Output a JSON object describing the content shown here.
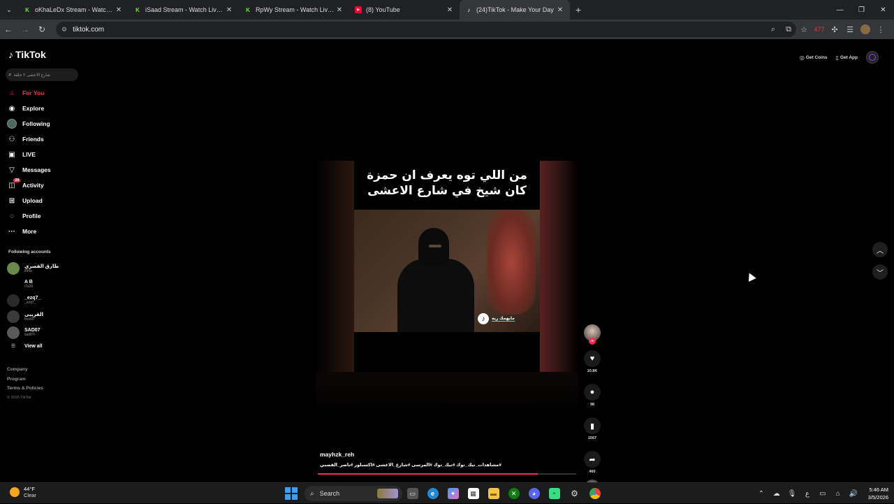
{
  "browser": {
    "tabs": [
      {
        "title": "oKhaLeDx Stream - Watch Live",
        "favicon": "kick-icon",
        "active": false
      },
      {
        "title": "iSaad Stream - Watch Live on K",
        "favicon": "kick-icon",
        "active": false
      },
      {
        "title": "RpWy Stream - Watch Live on K",
        "favicon": "kick-icon",
        "active": false
      },
      {
        "title": "(8) YouTube",
        "favicon": "youtube-icon",
        "active": false
      },
      {
        "title": "(24)TikTok - Make Your Day",
        "favicon": "tiktok-icon",
        "active": true
      }
    ],
    "url": "tiktok.com",
    "extension_badge": "477"
  },
  "sidebar": {
    "logo": "TikTok",
    "search_placeholder": "شارع الاعشى ٢ حلقة",
    "nav": [
      {
        "label": "For You",
        "icon": "home-icon",
        "active": true
      },
      {
        "label": "Explore",
        "icon": "compass-icon",
        "active": false
      },
      {
        "label": "Following",
        "icon": "following-icon",
        "active": false
      },
      {
        "label": "Friends",
        "icon": "friends-icon",
        "active": false
      },
      {
        "label": "LIVE",
        "icon": "live-icon",
        "active": false
      },
      {
        "label": "Messages",
        "icon": "messages-icon",
        "active": false
      },
      {
        "label": "Activity",
        "icon": "activity-icon",
        "active": false,
        "badge": "24"
      },
      {
        "label": "Upload",
        "icon": "upload-icon",
        "active": false
      },
      {
        "label": "Profile",
        "icon": "profile-icon",
        "active": false
      },
      {
        "label": "More",
        "icon": "more-icon",
        "active": false
      }
    ],
    "following_title": "Following accounts",
    "following": [
      {
        "name": "طارق القصري",
        "username": "lf94a",
        "color": "#6a8a4a"
      },
      {
        "name": "A B",
        "username": "i7a35",
        "color": "#000000"
      },
      {
        "name": "_ezq7_",
        "username": "_ezq7_",
        "color": "#2a2a2a"
      },
      {
        "name": "القريبي",
        "username": "fxrs60",
        "color": "#3a3a3a"
      },
      {
        "name": "SAD07",
        "username": "sad07l",
        "color": "#5a5a5a"
      }
    ],
    "view_all": "View all",
    "footer": [
      "Company",
      "Program",
      "Terms & Policies"
    ],
    "copyright": "© 2026 TikTok"
  },
  "header": {
    "get_coins": "Get Coins",
    "get_app": "Get App"
  },
  "video": {
    "caption": "من اللي توه يعرف ان حمزة كان شيخ في شارع الاعشى",
    "watermark": "مايهمك ريه",
    "author": "mayhzk_reh",
    "hashtags": "#مشاهدات_تيك_توك #تيك_توك #المرسى #شارع_الاعشى #اكسبلور #ناصر_القصبي",
    "progress": 0.85
  },
  "actions": {
    "likes": "10.8K",
    "comments": "98",
    "saves": "1567",
    "shares": "460"
  },
  "taskbar": {
    "temp": "44°F",
    "condition": "Clear",
    "search": "Search",
    "time": "5:46 AM",
    "date": "3/5/2026"
  }
}
